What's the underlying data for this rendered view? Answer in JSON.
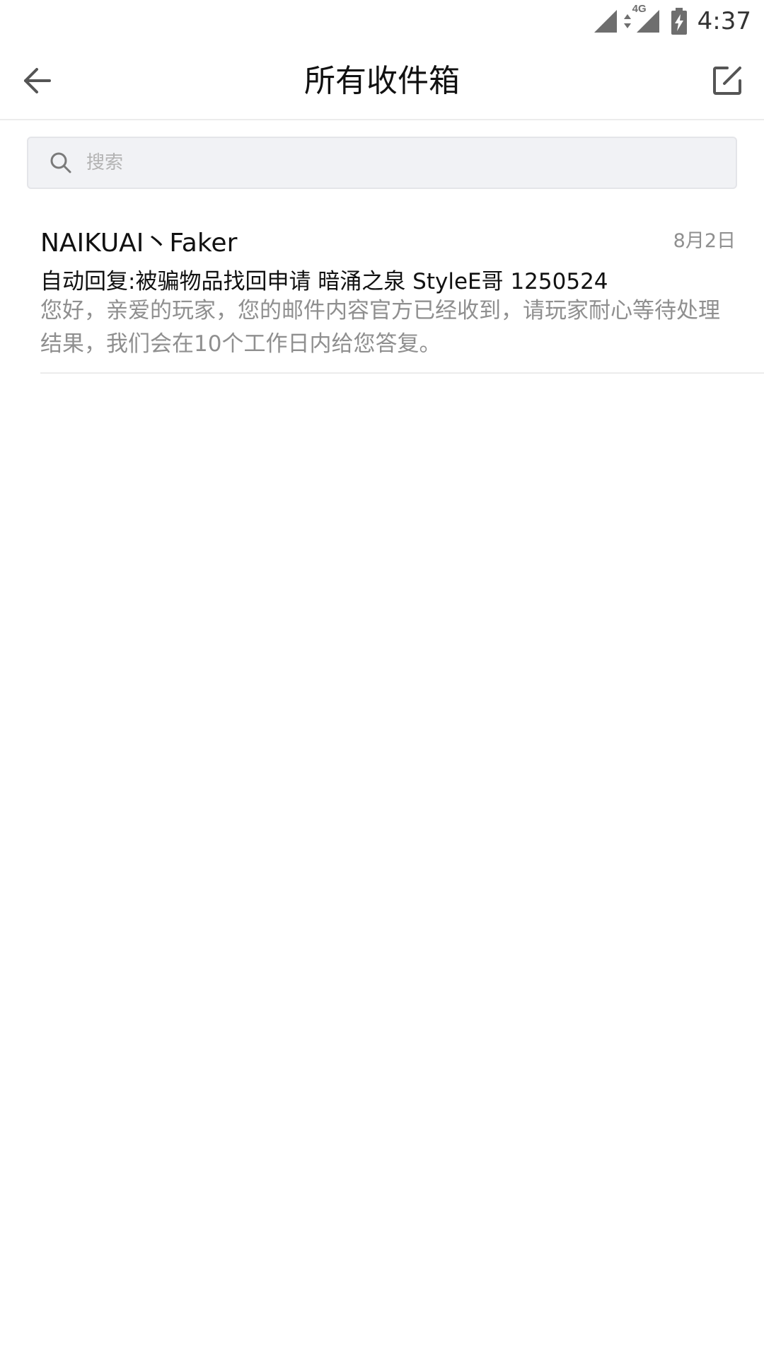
{
  "status_bar": {
    "network_label": "4G",
    "time": "4:37",
    "icons": [
      "signal-icon",
      "data-arrows-icon",
      "signal-4g-icon",
      "battery-charging-icon"
    ]
  },
  "app_bar": {
    "title": "所有收件箱",
    "back_icon": "back-arrow-icon",
    "compose_icon": "compose-icon"
  },
  "search": {
    "placeholder": "搜索",
    "value": ""
  },
  "mails": [
    {
      "sender": "NAIKUAI丶Faker",
      "date": "8月2日",
      "subject": "自动回复:被骗物品找回申请 暗涌之泉 StyleE哥 1250524",
      "preview": "您好，亲爱的玩家，您的邮件内容官方已经收到，请玩家耐心等待处理结果，我们会在10个工作日内给您答复。"
    }
  ]
}
